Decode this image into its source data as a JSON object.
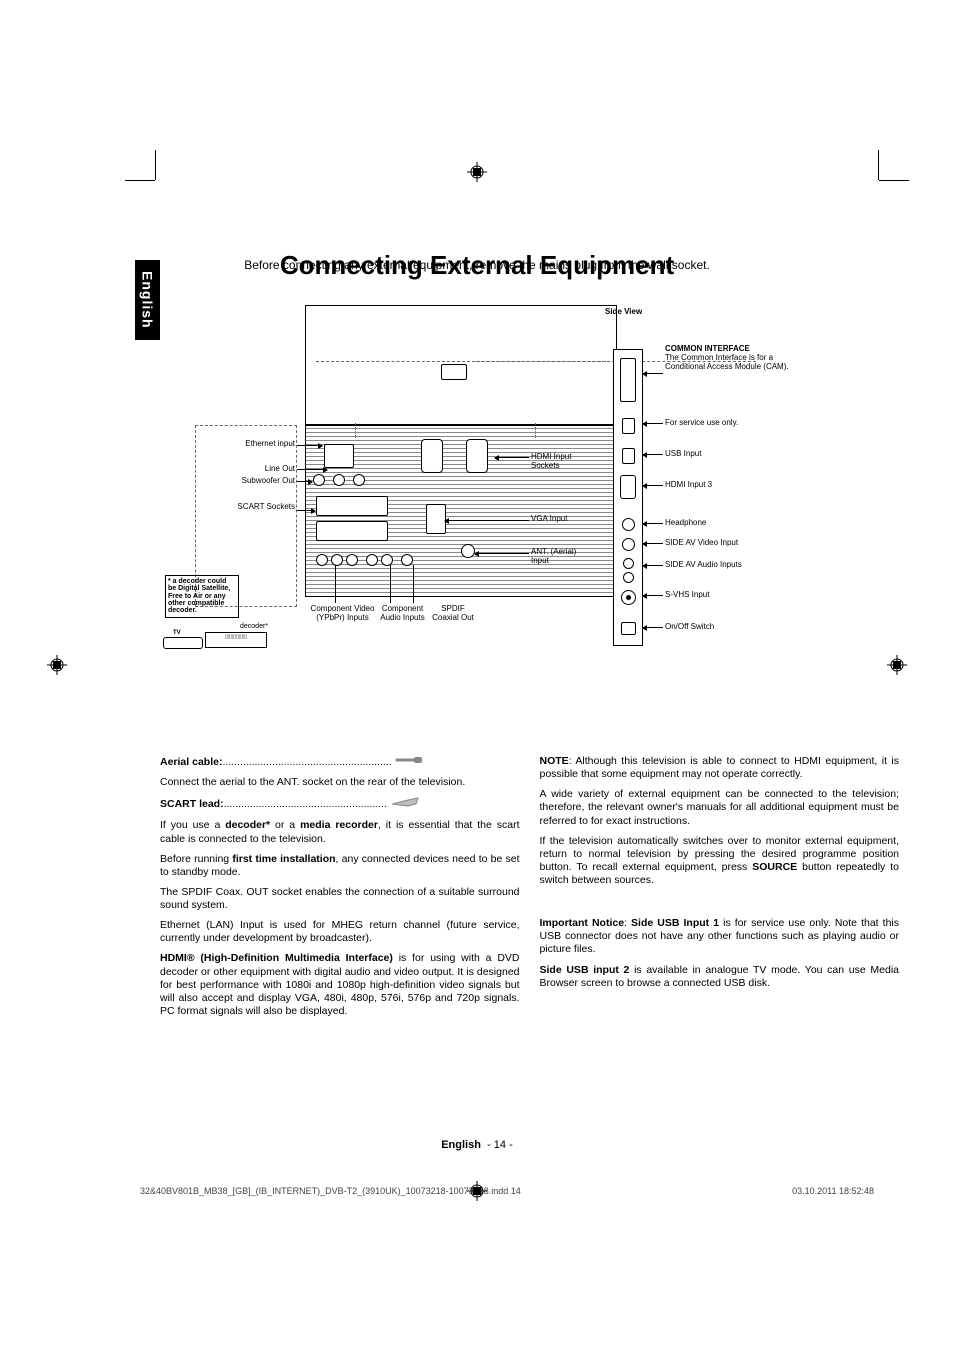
{
  "page": {
    "title": "Connecting External Equipment",
    "subtitle": "Before connecting any external equipment, remove the mains plug from the wall socket.",
    "language_tab": "English",
    "footer_lang": "English",
    "footer_page": "- 14 -",
    "print_left": "32&40BV801B_MB38_[GB]_(IB_INTERNET)_DVB-T2_(3910UK)_10073218-10073218.indd   14",
    "print_right": "03.10.2011   18:52:48"
  },
  "diagram": {
    "side_view": "Side View",
    "left_labels": {
      "ethernet": "Ethernet input",
      "lineout": "Line Out",
      "subwoofer": "Subwoofer Out",
      "scart": "SCART Sockets"
    },
    "bottom_labels": {
      "comp_video": "Component Video (YPbPr) Inputs",
      "comp_audio": "Component Audio Inputs",
      "spdif": "SPDIF Coaxial Out"
    },
    "mid_labels": {
      "hdmi": "HDMI Input Sockets",
      "vga": "VGA Input",
      "ant": "ANT. (Aerial) Input"
    },
    "right_labels": {
      "ci_title": "COMMON INTERFACE",
      "ci_desc": "The Common Interface is for a Conditional Access Module (CAM).",
      "service": "For service use only.",
      "usb": "USB Input",
      "hdmi3": "HDMI Input 3",
      "headphone": "Headphone",
      "sideav_v": "SIDE AV Video Input",
      "sideav_a": "SIDE AV Audio Inputs",
      "svhs": "S-VHS Input",
      "onoff": "On/Off Switch"
    },
    "decoder_note": "* a decoder could be Digital Satellite, Free to Air or any other compatible decoder.",
    "decoder_label": "decoder*",
    "tv_label": "TV"
  },
  "left_col": {
    "aerial_label": "Aerial cable:",
    "aerial_dots": "..........................................................",
    "aerial_text": "Connect the aerial to the ANT. socket on the rear of the television.",
    "scart_label": "SCART lead:",
    "scart_dots": "........................................................",
    "scart_text_1a": "If you use a ",
    "scart_text_1b": "decoder*",
    "scart_text_1c": " or a ",
    "scart_text_1d": "media recorder",
    "scart_text_1e": ", it is essential that the scart cable is connected to the television.",
    "before_1": "Before running ",
    "before_bold": "first time installation",
    "before_2": ", any connected devices need to be set to standby mode.",
    "spdif": "The SPDIF Coax. OUT socket enables the connection of a suitable surround sound system.",
    "ethernet": "Ethernet (LAN) Input is used for MHEG return channel (future service, currently under development by broadcaster).",
    "hdmi_bold": "HDMI® (High-Definition Multimedia Interface)",
    "hdmi_rest": " is for using with a DVD decoder or other equipment with digital audio and video output. It is designed for best performance with 1080i and 1080p high-definition video signals but will also accept and display VGA, 480i, 480p, 576i, 576p and 720p signals. PC format signals will also be displayed."
  },
  "right_col": {
    "note_bold": "NOTE",
    "note_rest": ": Although this television is able to connect to HDMI equipment, it is possible that some equipment may not operate correctly.",
    "variety": "A wide variety of external equipment can be connected to the television; therefore, the relevant owner's manuals for all additional equipment must be referred to for exact instructions.",
    "auto_1": "If the television automatically switches over to monitor external equipment, return to normal television by pressing the desired programme position button. To recall external equipment, press ",
    "auto_bold": "SOURCE",
    "auto_2": " button repeatedly to switch between sources.",
    "imp_1": "Important Notice",
    "imp_2": ": ",
    "imp_3": "Side USB Input 1",
    "imp_4": " is for service use only. Note that this USB connector does not have any other functions such as playing audio or picture files.",
    "side2_bold": "Side USB input 2",
    "side2_rest": " is available in analogue TV mode. You can use Media Browser screen to browse a connected USB disk."
  }
}
